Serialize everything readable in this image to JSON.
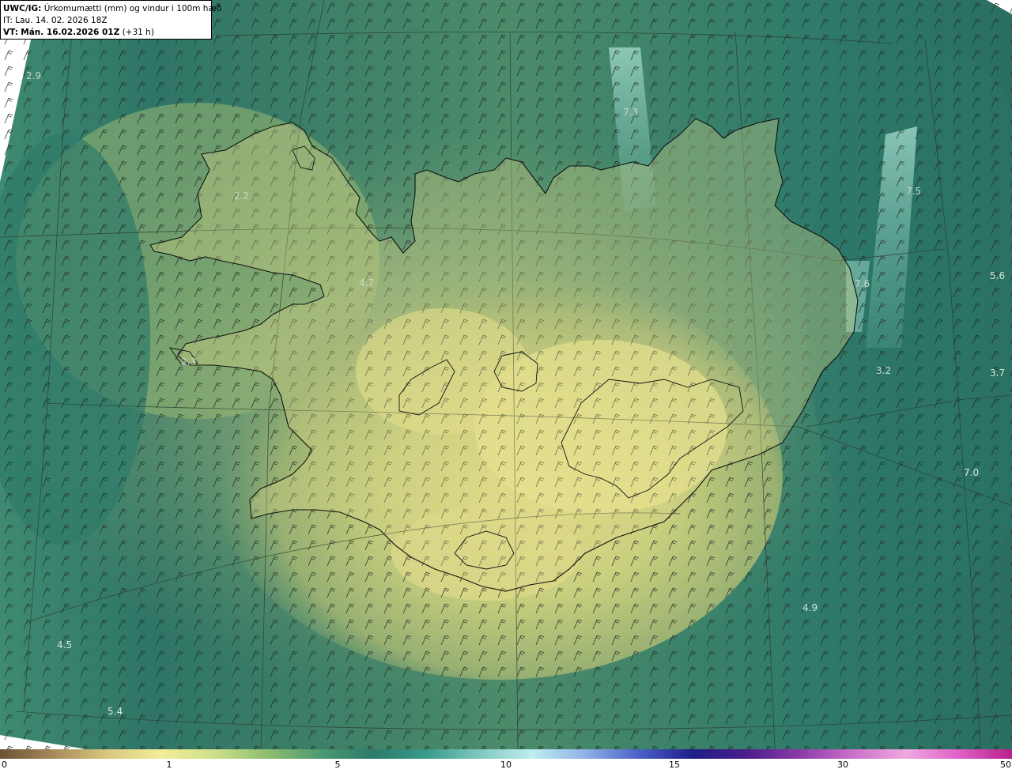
{
  "header": {
    "product": "UWC/IG:",
    "title": "Úrkomumætti (mm) og vindur i 100m hæð",
    "it_label": "IT:",
    "it_value": "Lau. 14. 02. 2026 18Z",
    "vt_label": "VT:",
    "vt_value": "Mán. 16.02.2026 01Z",
    "vt_offset": "(+31 h)"
  },
  "value_labels": [
    "2.9",
    "7.3",
    "7.5",
    "2.2",
    "5.6",
    "4.7",
    "7.6",
    "2.3",
    "3.2",
    "3.7",
    "7.0",
    "4.9",
    "4.5",
    "5.4"
  ],
  "colorbar": {
    "ticks": [
      "0",
      "1",
      "5",
      "10",
      "15",
      "30",
      "50"
    ],
    "colors": [
      "#6b5235",
      "#a88a5a",
      "#d8c67e",
      "#f2ee98",
      "#cfe08a",
      "#8fbf70",
      "#4d9a72",
      "#2d7a6a",
      "#3a9a8c",
      "#7fc8c0",
      "#bfeef0",
      "#8fb0e6",
      "#4a5fc8",
      "#1f1e8a",
      "#4a1e8a",
      "#8a3aa8",
      "#c870c8",
      "#f0a8e0",
      "#e060c8",
      "#b8208a"
    ]
  }
}
